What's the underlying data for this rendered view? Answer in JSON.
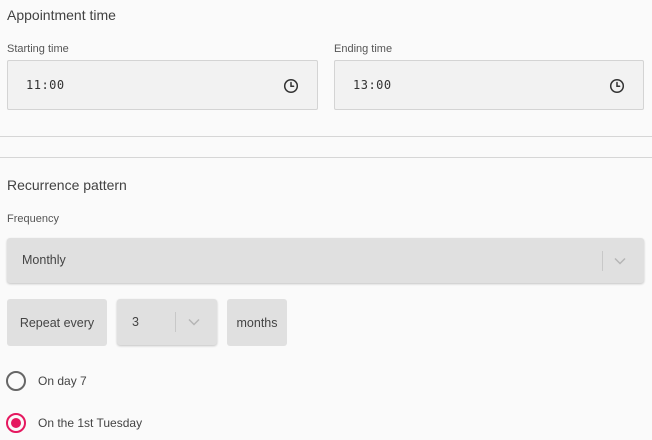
{
  "appointment": {
    "title": "Appointment time",
    "start_label": "Starting time",
    "start_value": "11:00",
    "end_label": "Ending time",
    "end_value": "13:00",
    "icon": "clock-icon"
  },
  "recurrence": {
    "title": "Recurrence pattern",
    "frequency_label": "Frequency",
    "frequency_value": "Monthly",
    "repeat_every_label": "Repeat every",
    "interval_value": "3",
    "interval_unit": "months",
    "options": [
      {
        "label": "On day 7",
        "checked": false
      },
      {
        "label": "On the 1st Tuesday",
        "checked": true
      }
    ]
  },
  "colors": {
    "accent": "#e5185f",
    "field_bg": "#f2f2f2",
    "select_bg": "#e0e0e0"
  }
}
